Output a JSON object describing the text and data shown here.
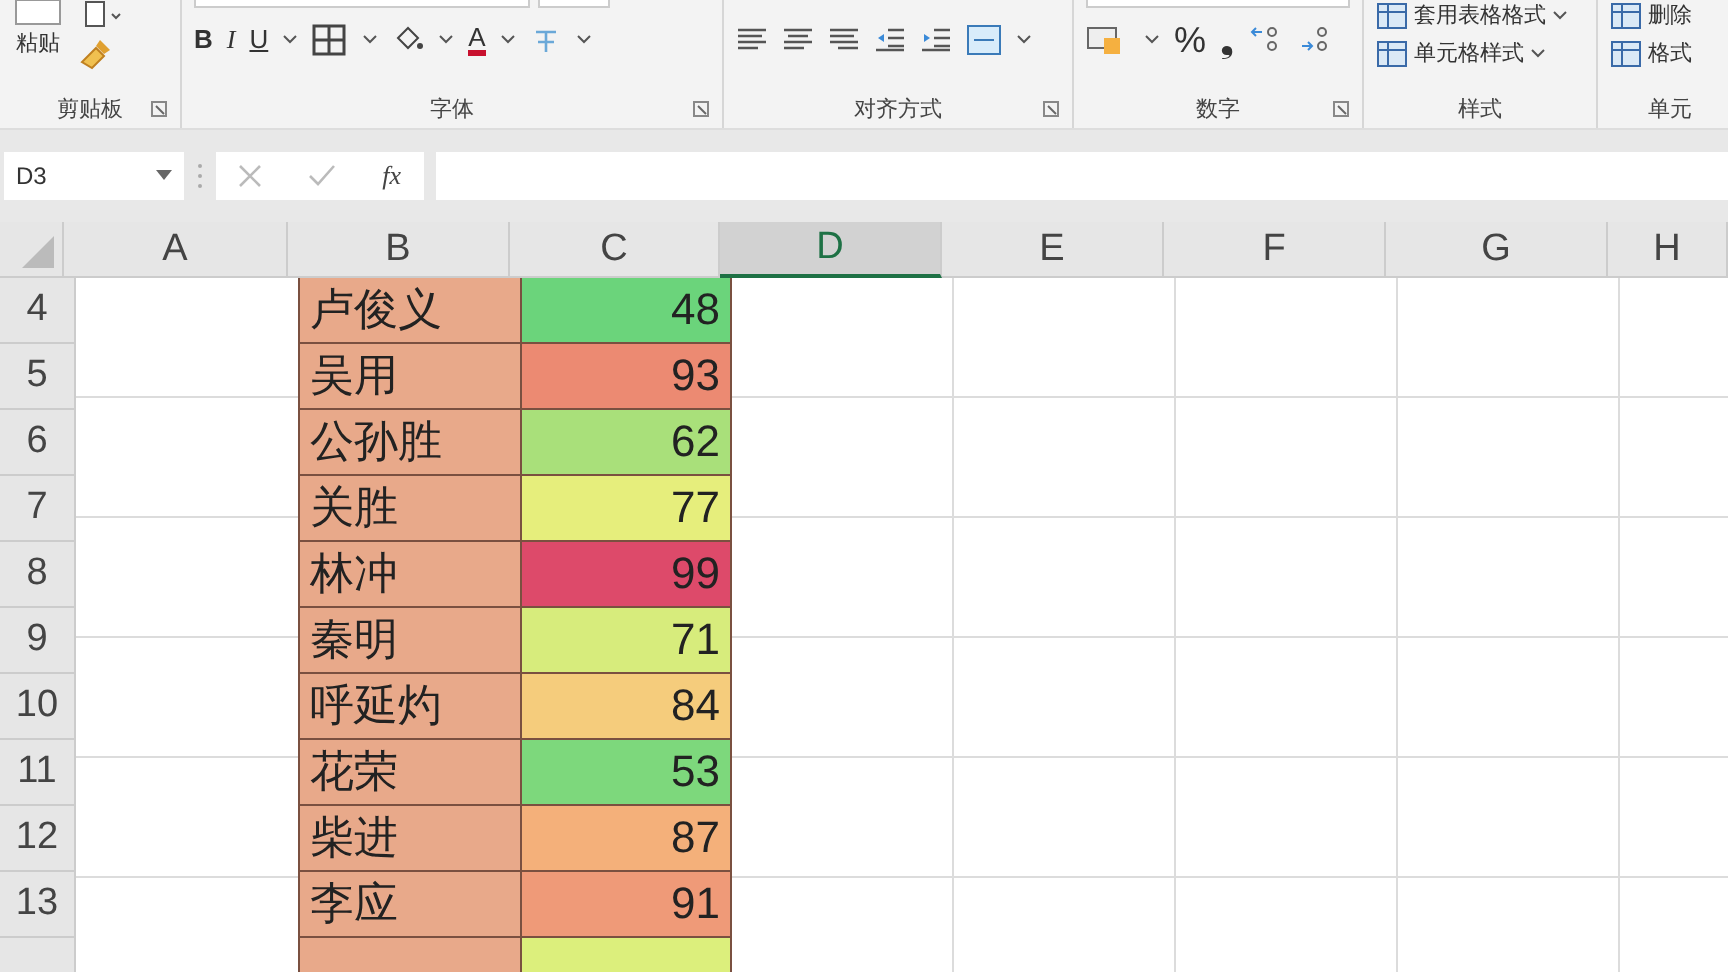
{
  "ribbon": {
    "groups": [
      {
        "kind": "clipboard",
        "label": "剪贴板",
        "paste": "粘贴"
      },
      {
        "kind": "font",
        "label": "字体",
        "bold": "B",
        "italic": "I",
        "underline": "U",
        "font_color": "A"
      },
      {
        "kind": "alignment",
        "label": "对齐方式"
      },
      {
        "kind": "number",
        "label": "数字",
        "percent": "%",
        "comma": "❟"
      },
      {
        "kind": "styles",
        "label": "样式",
        "items": [
          "套用表格格式",
          "单元格样式"
        ]
      },
      {
        "kind": "cells",
        "label": "单元",
        "items": [
          "删除",
          "格式"
        ]
      }
    ]
  },
  "name_box": "D3",
  "formula_label": "fx",
  "columns": [
    {
      "label": "A",
      "selected": false
    },
    {
      "label": "B",
      "selected": false
    },
    {
      "label": "C",
      "selected": false
    },
    {
      "label": "D",
      "selected": true
    },
    {
      "label": "E",
      "selected": false
    },
    {
      "label": "F",
      "selected": false
    },
    {
      "label": "G",
      "selected": false
    },
    {
      "label": "H",
      "selected": false
    }
  ],
  "rows": [
    {
      "number": "4",
      "name": "卢俊义",
      "score": "48",
      "color": "#6bd47b"
    },
    {
      "number": "5",
      "name": "吴用",
      "score": "93",
      "color": "#ec8a72"
    },
    {
      "number": "6",
      "name": "公孙胜",
      "score": "62",
      "color": "#a9e07a"
    },
    {
      "number": "7",
      "name": "关胜",
      "score": "77",
      "color": "#e6ee7c"
    },
    {
      "number": "8",
      "name": "林冲",
      "score": "99",
      "color": "#dd4a6a"
    },
    {
      "number": "9",
      "name": "秦明",
      "score": "71",
      "color": "#d7ec7c"
    },
    {
      "number": "10",
      "name": "呼延灼",
      "score": "84",
      "color": "#f5cc7c"
    },
    {
      "number": "11",
      "name": "花荣",
      "score": "53",
      "color": "#7dd87c"
    },
    {
      "number": "12",
      "name": "柴进",
      "score": "87",
      "color": "#f4b07a"
    },
    {
      "number": "13",
      "name": "李应",
      "score": "91",
      "color": "#ef9a78"
    },
    {
      "color": "#dcef7c"
    }
  ]
}
